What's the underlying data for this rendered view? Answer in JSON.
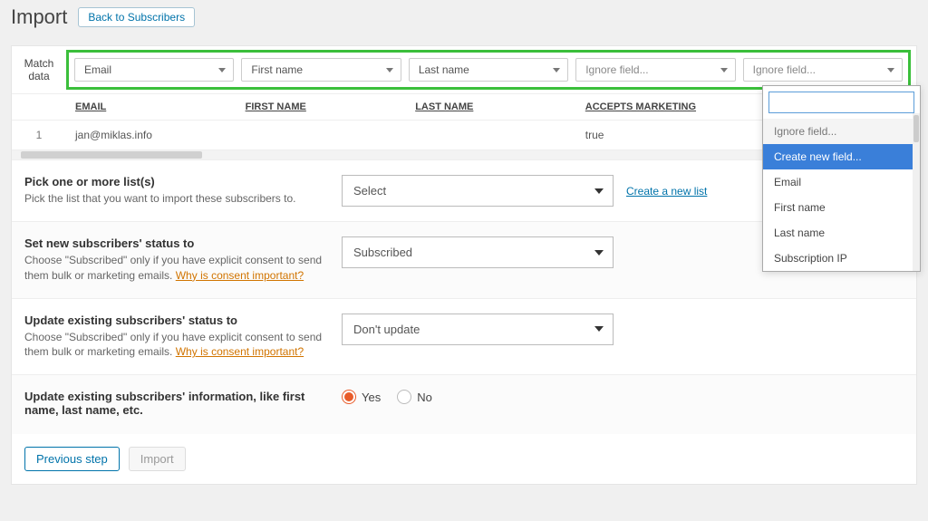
{
  "header": {
    "title": "Import",
    "back": "Back to Subscribers"
  },
  "match": {
    "label_line1": "Match",
    "label_line2": "data",
    "columns": [
      {
        "value": "Email",
        "placeholder": false
      },
      {
        "value": "First name",
        "placeholder": false
      },
      {
        "value": "Last name",
        "placeholder": false
      },
      {
        "value": "Ignore field...",
        "placeholder": true
      },
      {
        "value": "Ignore field...",
        "placeholder": true
      }
    ]
  },
  "table": {
    "headers": [
      "EMAIL",
      "FIRST NAME",
      "LAST NAME",
      "ACCEPTS MARKETING",
      ""
    ],
    "rows": [
      {
        "n": "1",
        "cells": [
          "jan@miklas.info",
          "",
          "",
          "true",
          ""
        ]
      }
    ]
  },
  "sections": {
    "lists": {
      "title": "Pick one or more list(s)",
      "sub": "Pick the list that you want to import these subscribers to.",
      "select": "Select",
      "link": "Create a new list"
    },
    "status": {
      "title": "Set new subscribers' status to",
      "sub": "Choose \"Subscribed\" only if you have explicit consent to send them bulk or marketing emails. ",
      "consent_link": "Why is consent important?",
      "select": "Subscribed"
    },
    "update_status": {
      "title": "Update existing subscribers' status to",
      "sub": "Choose \"Subscribed\" only if you have explicit consent to send them bulk or marketing emails. ",
      "consent_link": "Why is consent important?",
      "select": "Don't update"
    },
    "update_info": {
      "title": "Update existing subscribers' information, like first name, last name, etc.",
      "yes": "Yes",
      "no": "No"
    }
  },
  "footer": {
    "prev": "Previous step",
    "import": "Import"
  },
  "dropdown": {
    "search": "",
    "options": [
      {
        "label": "Ignore field...",
        "state": "muted"
      },
      {
        "label": "Create new field...",
        "state": "highlighted"
      },
      {
        "label": "Email",
        "state": ""
      },
      {
        "label": "First name",
        "state": ""
      },
      {
        "label": "Last name",
        "state": ""
      },
      {
        "label": "Subscription IP",
        "state": ""
      }
    ]
  }
}
